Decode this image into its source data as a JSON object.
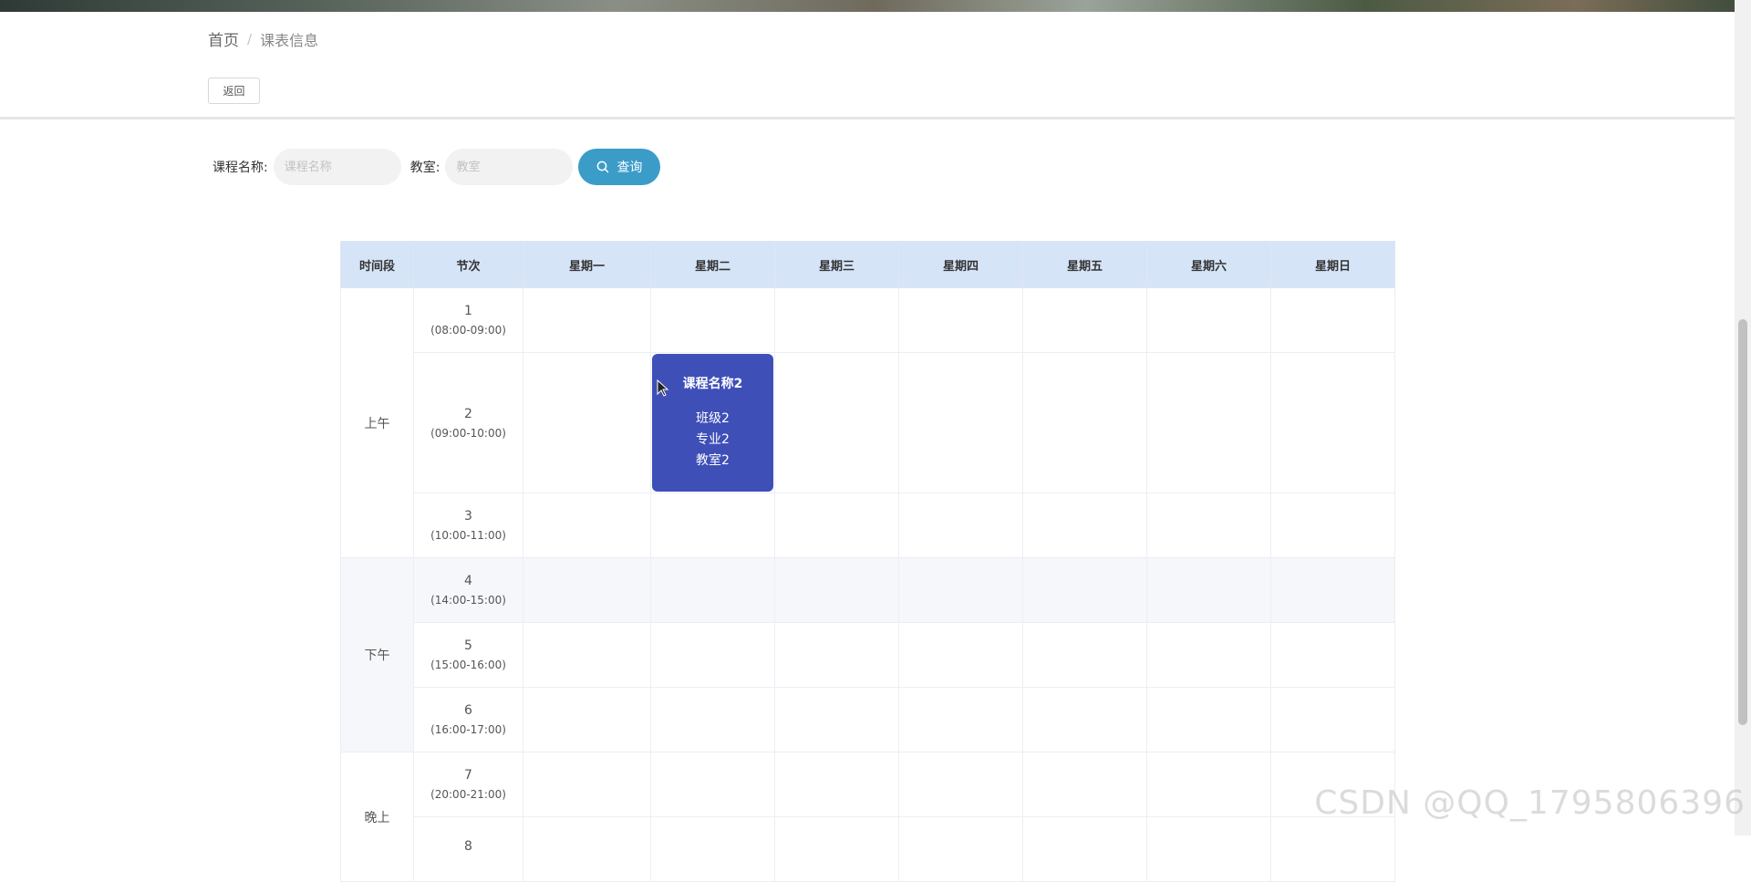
{
  "breadcrumb": {
    "home": "首页",
    "separator": "/",
    "current": "课表信息"
  },
  "back_button": "返回",
  "search": {
    "course_label": "课程名称:",
    "course_placeholder": "课程名称",
    "classroom_label": "教室:",
    "classroom_placeholder": "教室",
    "query_button": "查询"
  },
  "schedule": {
    "headers": [
      "时间段",
      "节次",
      "星期一",
      "星期二",
      "星期三",
      "星期四",
      "星期五",
      "星期六",
      "星期日"
    ],
    "periods": [
      "上午",
      "下午",
      "晚上"
    ],
    "slots": [
      {
        "num": "1",
        "time": "(08:00-09:00)"
      },
      {
        "num": "2",
        "time": "(09:00-10:00)"
      },
      {
        "num": "3",
        "time": "(10:00-11:00)"
      },
      {
        "num": "4",
        "time": "(14:00-15:00)"
      },
      {
        "num": "5",
        "time": "(15:00-16:00)"
      },
      {
        "num": "6",
        "time": "(16:00-17:00)"
      },
      {
        "num": "7",
        "time": "(20:00-21:00)"
      },
      {
        "num": "8",
        "time": ""
      }
    ],
    "course": {
      "name": "课程名称2",
      "class": "班级2",
      "major": "专业2",
      "room": "教室2",
      "color": "#3f4fb8"
    }
  },
  "watermark": "CSDN @QQ_1795806396"
}
